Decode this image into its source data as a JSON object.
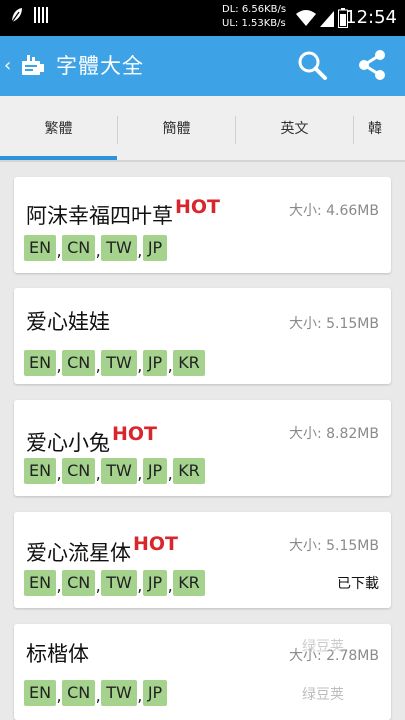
{
  "status_bar": {
    "net_down": "DL: 6.56KB/s",
    "net_up": "UL: 1.53KB/s",
    "time": "12:54"
  },
  "app_bar": {
    "back_glyph": "‹",
    "title": "字體大全"
  },
  "tabs": [
    {
      "label": "繁體",
      "active": true
    },
    {
      "label": "簡體",
      "active": false
    },
    {
      "label": "英文",
      "active": false
    },
    {
      "label": "韓",
      "active": false
    }
  ],
  "hot_label": "HOT",
  "fonts": [
    {
      "name": "阿沫幸福四叶草",
      "hot": true,
      "size": "大小: 4.66MB",
      "langs": [
        "EN",
        "CN",
        "TW",
        "JP"
      ],
      "status": ""
    },
    {
      "name": "爱心娃娃",
      "hot": false,
      "size": "大小: 5.15MB",
      "langs": [
        "EN",
        "CN",
        "TW",
        "JP",
        "KR"
      ],
      "status": ""
    },
    {
      "name": "爱心小兔",
      "hot": true,
      "size": "大小: 8.82MB",
      "langs": [
        "EN",
        "CN",
        "TW",
        "JP",
        "KR"
      ],
      "status": ""
    },
    {
      "name": "爱心流星体",
      "hot": true,
      "size": "大小: 5.15MB",
      "langs": [
        "EN",
        "CN",
        "TW",
        "JP",
        "KR"
      ],
      "status": "已下載"
    },
    {
      "name": "标楷体",
      "hot": false,
      "size": "大小: 2.78MB",
      "langs": [
        "EN",
        "CN",
        "TW",
        "JP"
      ],
      "status": ""
    }
  ],
  "watermark": "绿豆荚",
  "colors": {
    "app_bar": "#3da3e6",
    "tab_indicator": "#2f93d9",
    "lang_badge": "#a5d28d",
    "hot": "#d9262c"
  }
}
